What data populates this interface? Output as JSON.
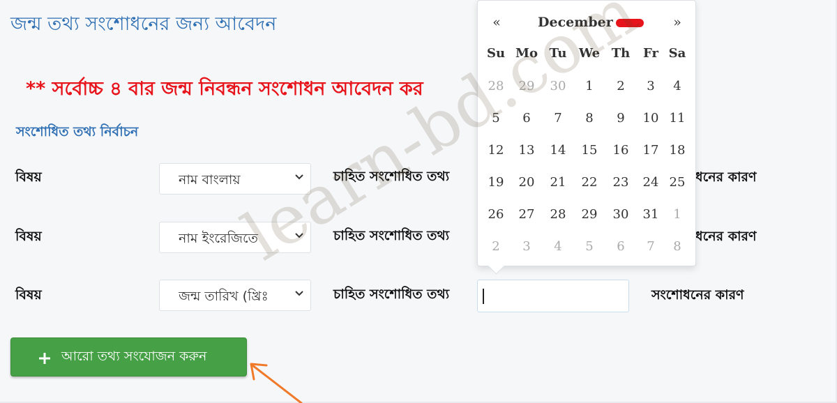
{
  "page": {
    "title": "জন্ম তথ্য সংশোধনের জন্য আবেদন",
    "warning": "** সর্বোচ্চ ৪ বার জন্ম নিবন্ধন সংশোধন আবেদন কর",
    "section_title": "সংশোধিত তথ্য নির্বাচন"
  },
  "rows": [
    {
      "subject_label": "বিষয়",
      "select_value": "নাম বাংলায়",
      "wanted_label": "চাহিত সংশোধিত তথ্য",
      "reason_label": "ধনের কারণ"
    },
    {
      "subject_label": "বিষয়",
      "select_value": "নাম ইংরেজিতে",
      "wanted_label": "চাহিত সংশোধিত তথ্য",
      "reason_label": "ধনের কারণ"
    },
    {
      "subject_label": "বিষয়",
      "select_value": "জন্ম তারিখ (খ্রিঃ",
      "wanted_label": "চাহিত সংশোধিত তথ্য",
      "reason_label": "সংশোধনের কারণ"
    }
  ],
  "add_button": {
    "label": "আরো তথ্য সংযোজন করুন",
    "icon": "plus-icon"
  },
  "calendar": {
    "prev": "«",
    "next": "»",
    "month": "December",
    "weekdays": [
      "Su",
      "Mo",
      "Tu",
      "We",
      "Th",
      "Fr",
      "Sa"
    ],
    "weeks": [
      [
        {
          "d": "28",
          "m": true
        },
        {
          "d": "29",
          "m": true
        },
        {
          "d": "30",
          "m": true
        },
        {
          "d": "1"
        },
        {
          "d": "2"
        },
        {
          "d": "3"
        },
        {
          "d": "4"
        }
      ],
      [
        {
          "d": "5"
        },
        {
          "d": "6"
        },
        {
          "d": "7"
        },
        {
          "d": "8"
        },
        {
          "d": "9"
        },
        {
          "d": "10"
        },
        {
          "d": "11"
        }
      ],
      [
        {
          "d": "12"
        },
        {
          "d": "13"
        },
        {
          "d": "14"
        },
        {
          "d": "15"
        },
        {
          "d": "16"
        },
        {
          "d": "17"
        },
        {
          "d": "18"
        }
      ],
      [
        {
          "d": "19"
        },
        {
          "d": "20"
        },
        {
          "d": "21"
        },
        {
          "d": "22"
        },
        {
          "d": "23"
        },
        {
          "d": "24"
        },
        {
          "d": "25"
        }
      ],
      [
        {
          "d": "26"
        },
        {
          "d": "27"
        },
        {
          "d": "28"
        },
        {
          "d": "29"
        },
        {
          "d": "30"
        },
        {
          "d": "31"
        },
        {
          "d": "1",
          "m": true
        }
      ],
      [
        {
          "d": "2",
          "m": true
        },
        {
          "d": "3",
          "m": true
        },
        {
          "d": "4",
          "m": true
        },
        {
          "d": "5",
          "m": true
        },
        {
          "d": "6",
          "m": true
        },
        {
          "d": "7",
          "m": true
        },
        {
          "d": "8",
          "m": true
        }
      ]
    ]
  },
  "watermark": "learn-bd.com",
  "colors": {
    "title_blue": "#2f6fb3",
    "warning_red": "#e8141b",
    "button_green": "#46a046",
    "arrow_orange": "#f07a2a"
  }
}
